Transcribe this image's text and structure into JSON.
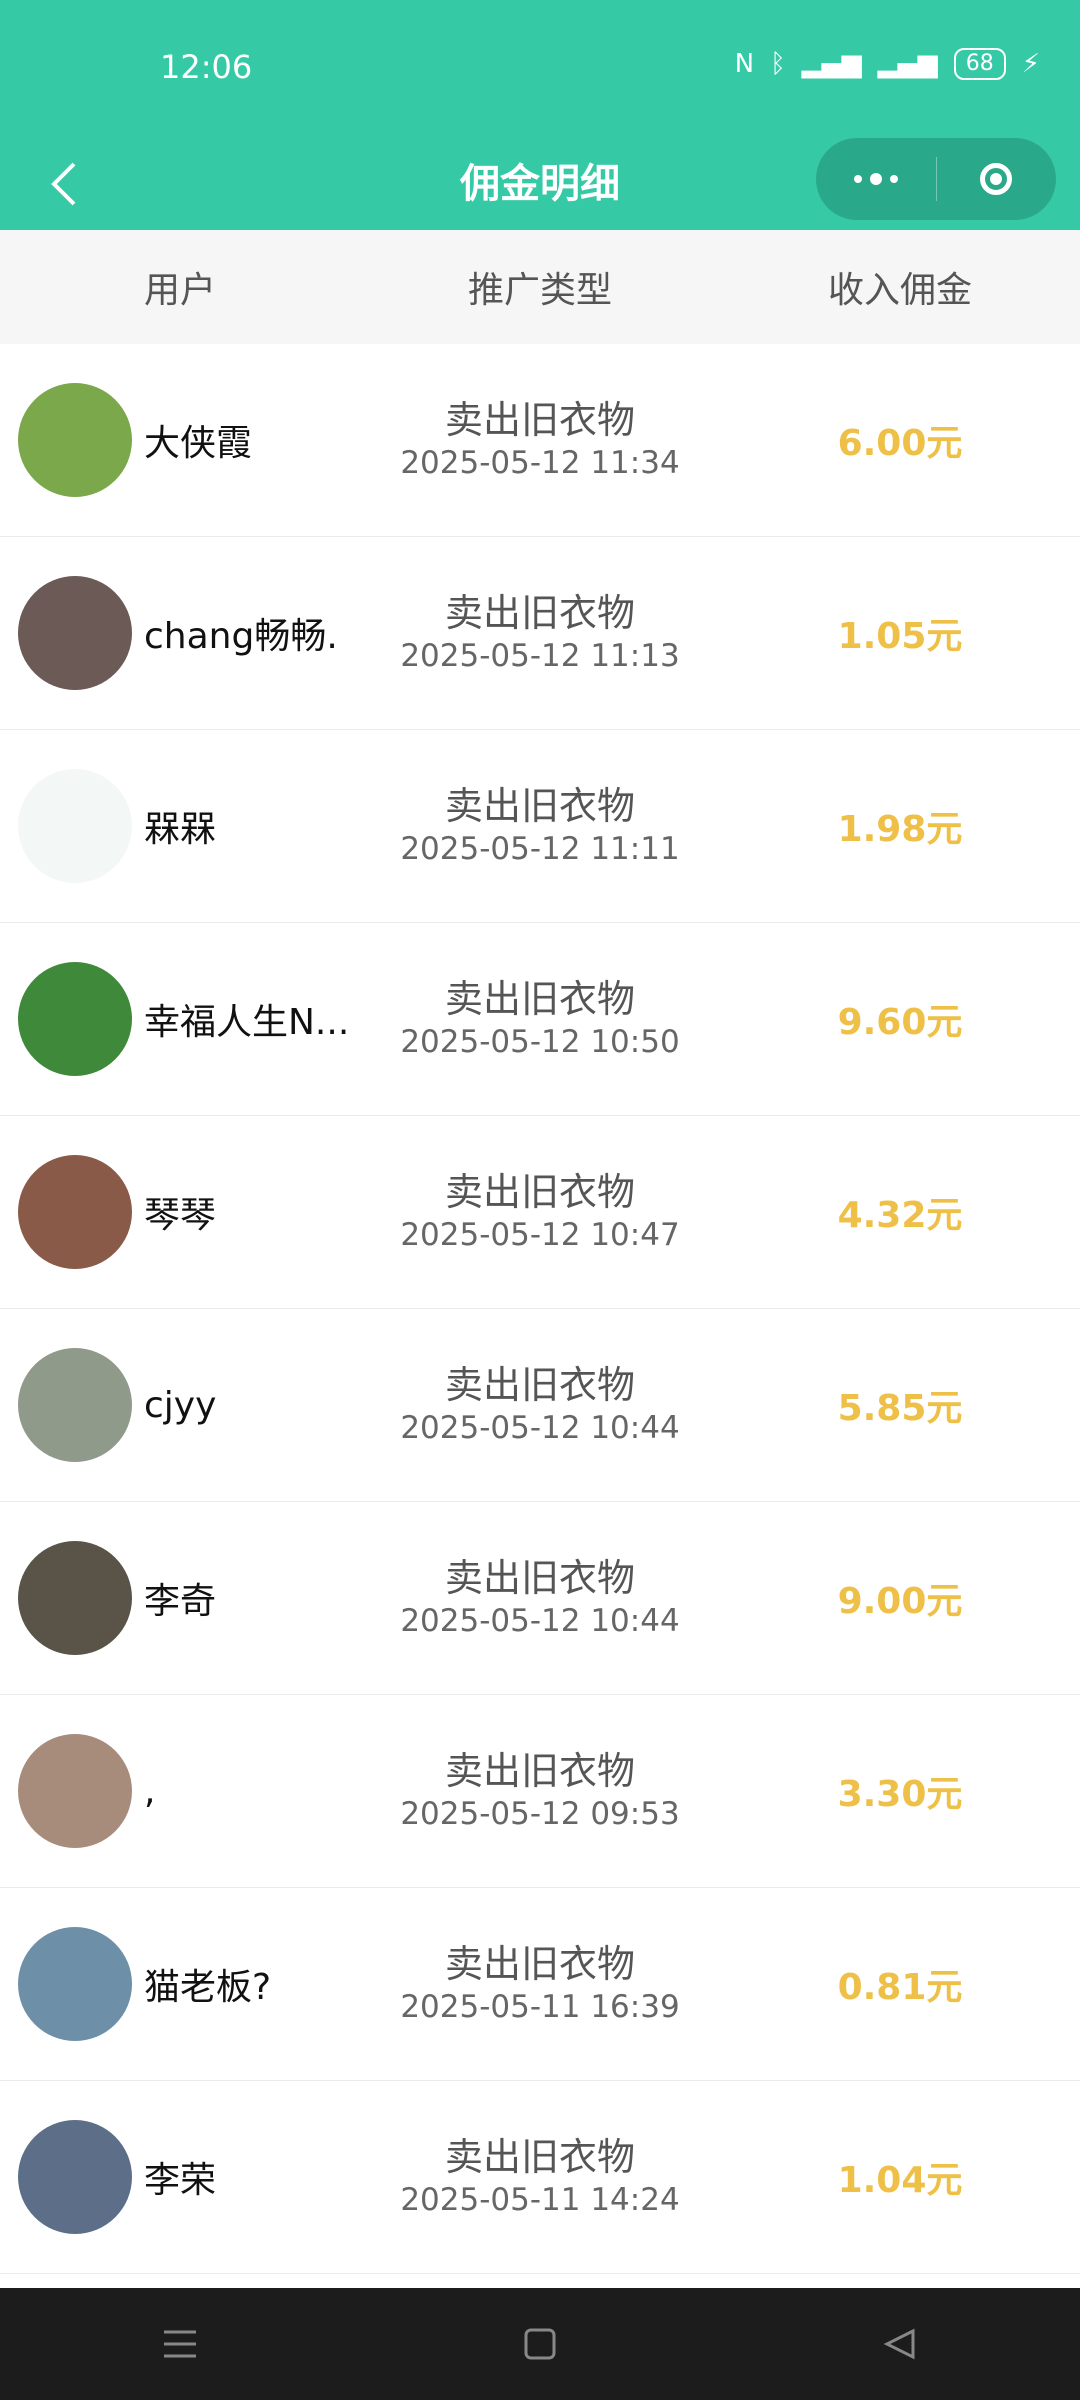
{
  "status": {
    "time": "12:06",
    "battery": "68"
  },
  "nav": {
    "title": "佣金明细"
  },
  "header": {
    "user": "用户",
    "type": "推广类型",
    "amount": "收入佣金"
  },
  "colors": {
    "accent": "#35c9a6",
    "amount": "#eec047"
  },
  "rows": [
    {
      "user": "大侠霞",
      "type": "卖出旧衣物",
      "time": "2025-05-12 11:34",
      "amount": "6.00元",
      "avatar_color": "#7aa84a"
    },
    {
      "user": "chang畅畅.",
      "type": "卖出旧衣物",
      "time": "2025-05-12 11:13",
      "amount": "1.05元",
      "avatar_color": "#6b5a55"
    },
    {
      "user": "槑槑",
      "type": "卖出旧衣物",
      "time": "2025-05-12 11:11",
      "amount": "1.98元",
      "avatar_color": "#f3f7f6"
    },
    {
      "user": "幸福人生N...",
      "type": "卖出旧衣物",
      "time": "2025-05-12 10:50",
      "amount": "9.60元",
      "avatar_color": "#3f8a3a"
    },
    {
      "user": "琴琴",
      "type": "卖出旧衣物",
      "time": "2025-05-12 10:47",
      "amount": "4.32元",
      "avatar_color": "#8a5a48"
    },
    {
      "user": "cjyy",
      "type": "卖出旧衣物",
      "time": "2025-05-12 10:44",
      "amount": "5.85元",
      "avatar_color": "#8f9a8a"
    },
    {
      "user": "李奇",
      "type": "卖出旧衣物",
      "time": "2025-05-12 10:44",
      "amount": "9.00元",
      "avatar_color": "#5a5347"
    },
    {
      "user": ",",
      "type": "卖出旧衣物",
      "time": "2025-05-12 09:53",
      "amount": "3.30元",
      "avatar_color": "#a78c7c"
    },
    {
      "user": "猫老板?",
      "type": "卖出旧衣物",
      "time": "2025-05-11 16:39",
      "amount": "0.81元",
      "avatar_color": "#6e8fa8"
    },
    {
      "user": "李荣",
      "type": "卖出旧衣物",
      "time": "2025-05-11 14:24",
      "amount": "1.04元",
      "avatar_color": "#5d6f88"
    }
  ]
}
